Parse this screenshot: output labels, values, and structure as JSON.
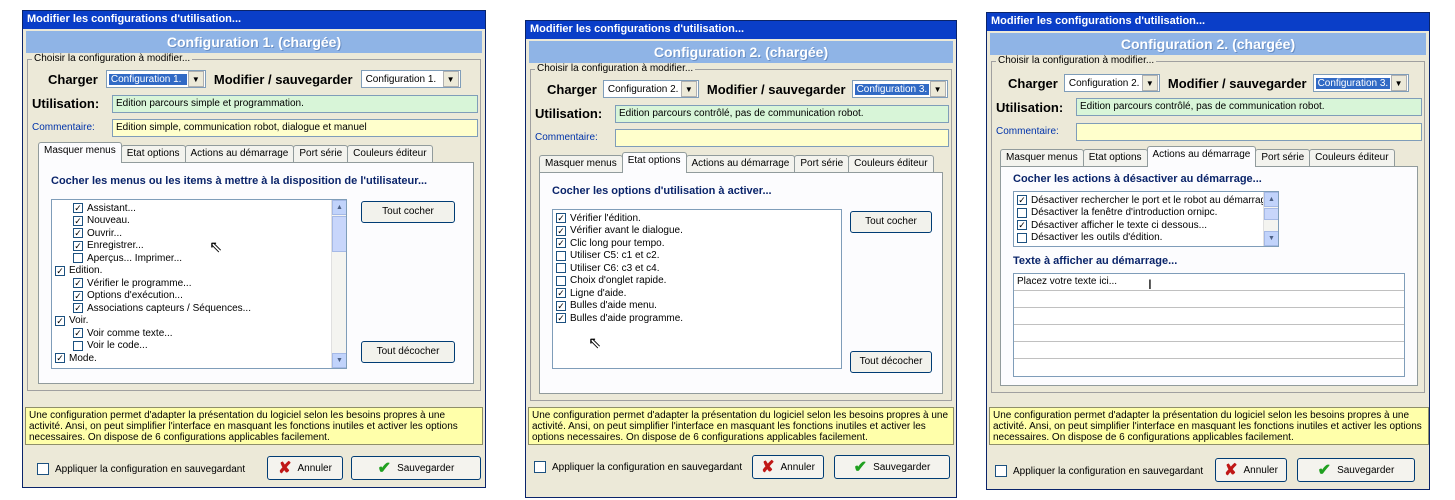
{
  "common": {
    "window_title": "Modifier les configurations d'utilisation...",
    "choose_label": "Choisir la configuration à modifier...",
    "charger_label": "Charger",
    "modifier_label": "Modifier / sauvegarder",
    "utilisation_label": "Utilisation:",
    "commentaire_label": "Commentaire:",
    "tabs": [
      "Masquer menus",
      "Etat options",
      "Actions au démarrage",
      "Port série",
      "Couleurs éditeur"
    ],
    "info_text": "Une configuration permet d'adapter la présentation du logiciel selon les besoins propres à une activité. Ansi, on peut simplifier l'interface en masquant les fonctions inutiles et activer les options necessaires.  On dispose de 6 configurations applicables facilement.",
    "apply_label": "Appliquer la configuration en sauvegardant",
    "cancel_label": "Annuler",
    "save_label": "Sauvegarder",
    "check_all": "Tout cocher",
    "uncheck_all": "Tout décocher"
  },
  "win1": {
    "band": "Configuration 1.  (chargée)",
    "charger_value": "Configuration 1.",
    "modifier_value": "Configuration 1.",
    "utilisation": "Edition parcours simple et programmation.",
    "commentaire": "Edition simple, communication robot, dialogue et manuel",
    "panel_heading": "Cocher les menus ou les items à mettre à la disposition de l'utilisateur...",
    "items": [
      {
        "label": "Assistant...",
        "checked": true,
        "indent": true
      },
      {
        "label": "Nouveau.",
        "checked": true,
        "indent": true
      },
      {
        "label": "Ouvrir...",
        "checked": true,
        "indent": true
      },
      {
        "label": "Enregistrer...",
        "checked": true,
        "indent": true
      },
      {
        "label": "Aperçus... Imprimer...",
        "checked": false,
        "indent": true
      },
      {
        "label": "Edition.",
        "checked": true,
        "indent": false
      },
      {
        "label": "Vérifier le programme...",
        "checked": true,
        "indent": true
      },
      {
        "label": "Options d'exécution...",
        "checked": true,
        "indent": true
      },
      {
        "label": "Associations capteurs / Séquences...",
        "checked": true,
        "indent": true
      },
      {
        "label": "Voir.",
        "checked": true,
        "indent": false
      },
      {
        "label": "Voir comme texte...",
        "checked": true,
        "indent": true
      },
      {
        "label": "Voir le code...",
        "checked": false,
        "indent": true
      },
      {
        "label": "Mode.",
        "checked": true,
        "indent": false
      }
    ]
  },
  "win2": {
    "band": "Configuration 2.  (chargée)",
    "charger_value": "Configuration 2.",
    "modifier_value": "Configuration 3.",
    "utilisation": "Edition parcours contrôlé, pas de communication robot.",
    "commentaire": "",
    "panel_heading": "Cocher les options d'utilisation à activer...",
    "items": [
      {
        "label": "Vérifier l'édition.",
        "checked": true
      },
      {
        "label": "Vérifier avant le dialogue.",
        "checked": true
      },
      {
        "label": "Clic long pour tempo.",
        "checked": true
      },
      {
        "label": "Utiliser C5: c1 et c2.",
        "checked": false
      },
      {
        "label": "Utiliser C6: c3 et c4.",
        "checked": false
      },
      {
        "label": "Choix d'onglet rapide.",
        "checked": false
      },
      {
        "label": "Ligne d'aide.",
        "checked": true
      },
      {
        "label": "Bulles d'aide menu.",
        "checked": true
      },
      {
        "label": "Bulles d'aide programme.",
        "checked": true
      }
    ]
  },
  "win3": {
    "band": "Configuration 2.  (chargée)",
    "charger_value": "Configuration 2.",
    "modifier_value": "Configuration 3.",
    "utilisation": "Edition parcours contrôlé, pas de communication robot.",
    "commentaire": "",
    "panel_heading": "Cocher les actions à désactiver au démarrage...",
    "items": [
      {
        "label": "Désactiver rechercher le port et le robot au démarrage.",
        "checked": true
      },
      {
        "label": "Désactiver la fenêtre d'introduction ornipc.",
        "checked": false
      },
      {
        "label": "Désactiver afficher le texte ci dessous...",
        "checked": true
      },
      {
        "label": "Désactiver les outils d'édition.",
        "checked": false
      }
    ],
    "text_heading": "Texte à afficher au  démarrage...",
    "text_value": "Placez votre texte ici..."
  }
}
